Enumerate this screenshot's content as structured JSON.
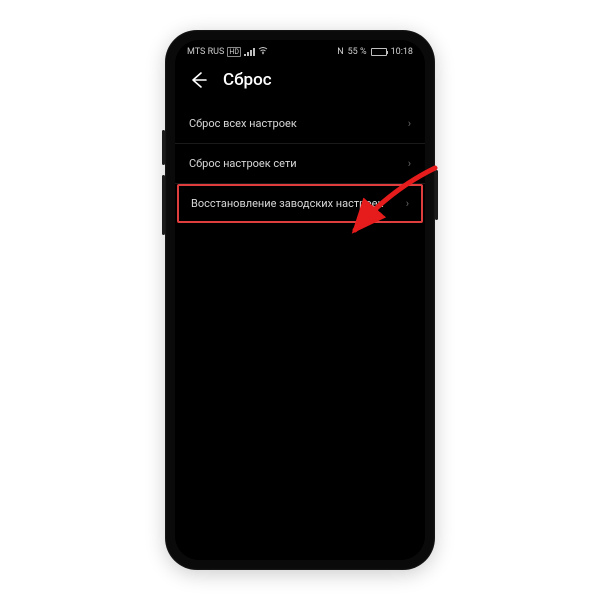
{
  "status": {
    "carrier": "MTS RUS",
    "network_badge": "HD",
    "nfc": "N",
    "battery_pct": "55 %",
    "time": "10:18"
  },
  "header": {
    "title": "Сброс"
  },
  "items": [
    {
      "label": "Сброс всех настроек"
    },
    {
      "label": "Сброс настроек сети"
    },
    {
      "label": "Восстановление заводских настроек"
    }
  ]
}
